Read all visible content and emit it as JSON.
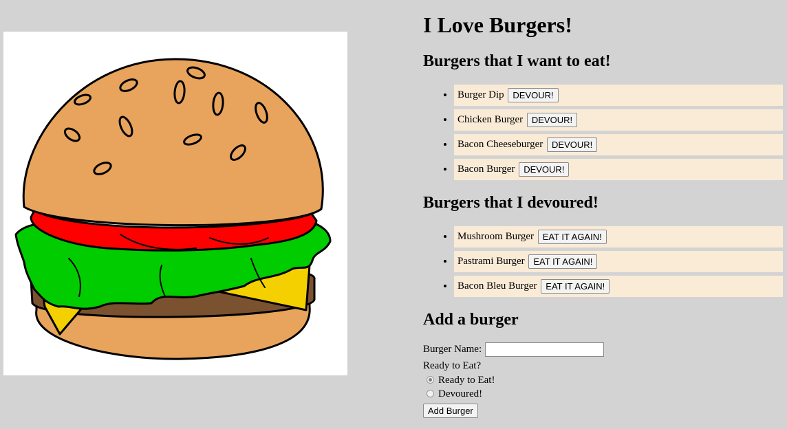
{
  "page": {
    "title": "I Love Burgers!",
    "to_eat_heading": "Burgers that I want to eat!",
    "devoured_heading": "Burgers that I devoured!",
    "add_heading": "Add a burger"
  },
  "to_eat": [
    {
      "name": "Burger Dip",
      "action": "DEVOUR!"
    },
    {
      "name": "Chicken Burger",
      "action": "DEVOUR!"
    },
    {
      "name": "Bacon Cheeseburger",
      "action": "DEVOUR!"
    },
    {
      "name": "Bacon Burger",
      "action": "DEVOUR!"
    }
  ],
  "devoured": [
    {
      "name": "Mushroom Burger",
      "action": "EAT IT AGAIN!"
    },
    {
      "name": "Pastrami Burger",
      "action": "EAT IT AGAIN!"
    },
    {
      "name": "Bacon Bleu Burger",
      "action": "EAT IT AGAIN!"
    }
  ],
  "form": {
    "name_label": "Burger Name:",
    "name_value": "",
    "ready_label": "Ready to Eat?",
    "options": [
      {
        "label": "Ready to Eat!",
        "checked": true
      },
      {
        "label": "Devoured!",
        "checked": false
      }
    ],
    "submit_label": "Add Burger"
  },
  "hero": {
    "icon": "burger-illustration"
  },
  "colors": {
    "page_bg": "#d3d3d3",
    "list_item_bg": "#faebd7",
    "bun": "#e8a45c",
    "tomato": "#ff0000",
    "lettuce": "#00cc00",
    "cheese": "#f5d000",
    "patty": "#7b5230"
  }
}
